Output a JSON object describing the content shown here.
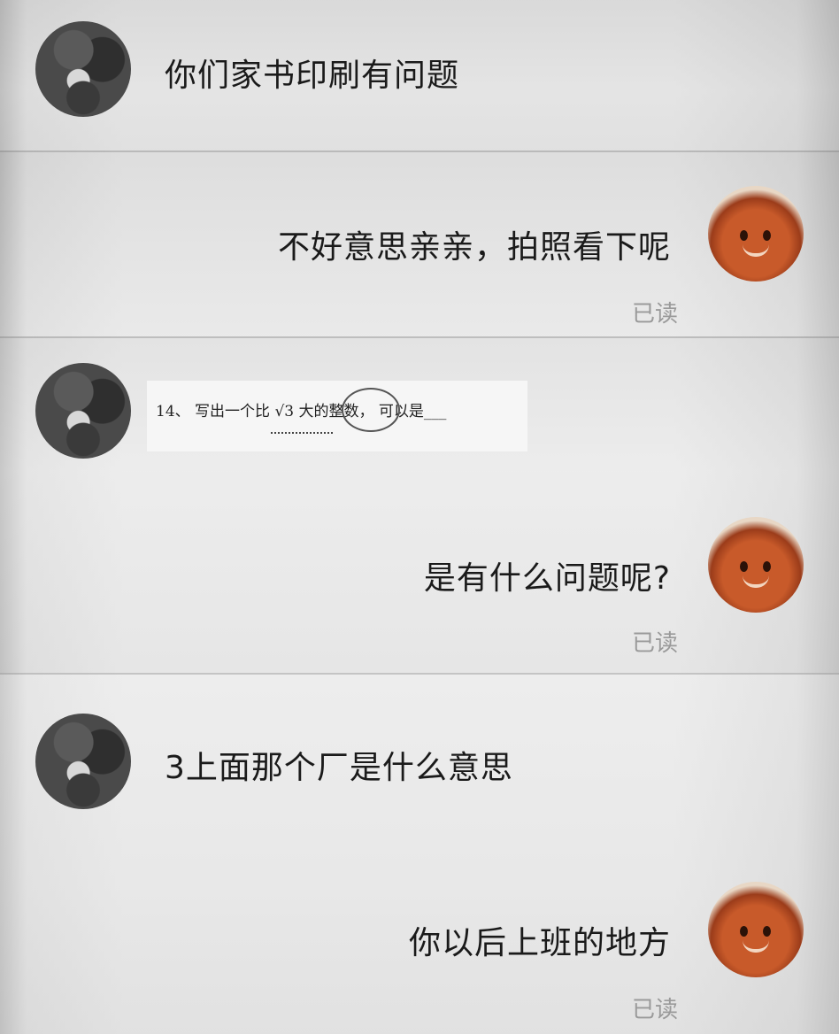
{
  "messages": [
    {
      "side": "left",
      "text": "你们家书印刷有问题"
    },
    {
      "side": "right",
      "text": "不好意思亲亲，拍照看下呢",
      "status": "已读"
    },
    {
      "side": "left",
      "type": "image",
      "exam": {
        "number": "14、",
        "prefix": "写出一个比",
        "radical": "√3",
        "middle": "大的整数，",
        "suffix": "可以是___"
      }
    },
    {
      "side": "right",
      "text": "是有什么问题呢?",
      "status": "已读"
    },
    {
      "side": "left",
      "text": "3上面那个厂是什么意思"
    },
    {
      "side": "right",
      "text": "你以后上班的地方",
      "status": "已读"
    }
  ],
  "icons": {
    "left_avatar": "user-avatar-icon",
    "right_avatar": "shop-mascot-avatar-icon"
  },
  "colors": {
    "text": "#1a1a1a",
    "read_status": "#9a9a9a",
    "mascot": "#c85a2a"
  }
}
